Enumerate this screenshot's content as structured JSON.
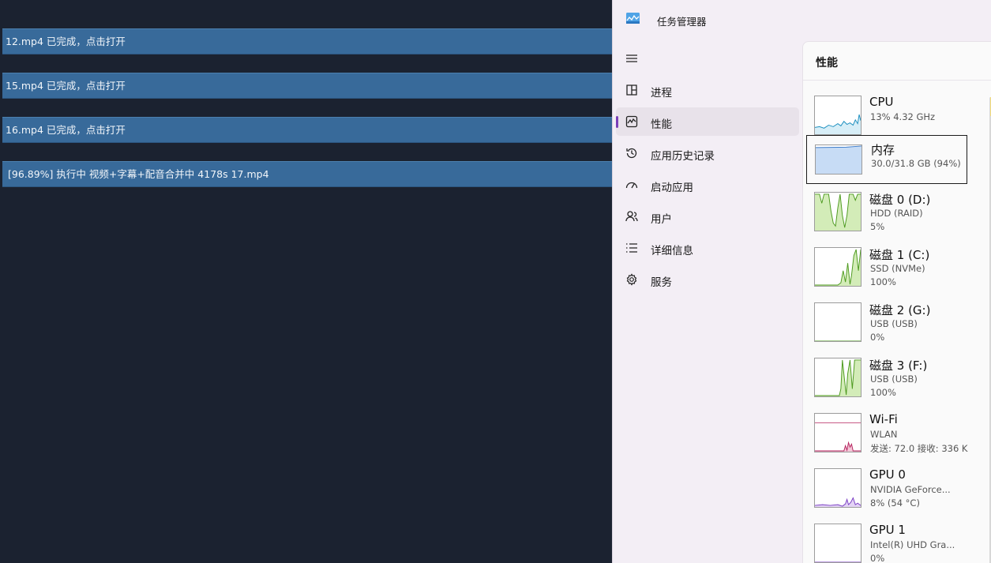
{
  "tasks": [
    {
      "text": "12.mp4  已完成，点击打开",
      "status": "done"
    },
    {
      "text": "15.mp4  已完成，点击打开",
      "status": "done"
    },
    {
      "text": "16.mp4  已完成，点击打开",
      "status": "done"
    },
    {
      "text": "[96.89%]  执行中 视频+字幕+配音合并中 4178s    17.mp4",
      "status": "running"
    }
  ],
  "task_manager": {
    "title": "任务管理器",
    "nav": [
      {
        "label": "进程",
        "icon": "processes-icon"
      },
      {
        "label": "性能",
        "icon": "performance-icon",
        "active": true
      },
      {
        "label": "应用历史记录",
        "icon": "history-icon"
      },
      {
        "label": "启动应用",
        "icon": "startup-icon"
      },
      {
        "label": "用户",
        "icon": "users-icon"
      },
      {
        "label": "详细信息",
        "icon": "details-icon"
      },
      {
        "label": "服务",
        "icon": "services-icon"
      }
    ],
    "section_title": "性能",
    "items": [
      {
        "name": "CPU",
        "sub": "13%  4.32 GHz",
        "sub2": "",
        "color": "#1b8fbf"
      },
      {
        "name": "内存",
        "sub": "30.0/31.8 GB (94%)",
        "sub2": "",
        "color": "#3d7cc9",
        "selected": true
      },
      {
        "name": "磁盘 0 (D:)",
        "sub": "HDD (RAID)",
        "sub2": "5%",
        "color": "#4d9a1e"
      },
      {
        "name": "磁盘 1 (C:)",
        "sub": "SSD (NVMe)",
        "sub2": "100%",
        "color": "#4d9a1e"
      },
      {
        "name": "磁盘 2 (G:)",
        "sub": "USB (USB)",
        "sub2": "0%",
        "color": "#4d9a1e"
      },
      {
        "name": "磁盘 3 (F:)",
        "sub": "USB (USB)",
        "sub2": "100%",
        "color": "#4d9a1e"
      },
      {
        "name": "Wi-Fi",
        "sub": "WLAN",
        "sub2": "发送: 72.0  接收: 336 K",
        "color": "#b6245f"
      },
      {
        "name": "GPU 0",
        "sub": "NVIDIA GeForce...",
        "sub2": "8% (54 °C)",
        "color": "#7b3fc4"
      },
      {
        "name": "GPU 1",
        "sub": "Intel(R) UHD Gra...",
        "sub2": "0%",
        "color": "#7b3fc4"
      }
    ]
  }
}
